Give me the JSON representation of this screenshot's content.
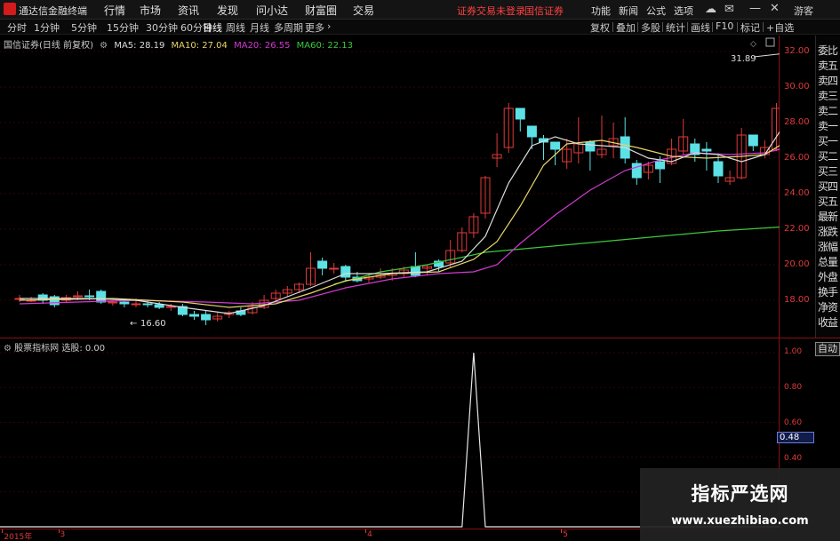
{
  "menubar": {
    "app_title": "通达信金融终端",
    "menu_items": [
      "行情",
      "市场",
      "资讯",
      "发现",
      "问小达",
      "财富圈",
      "交易"
    ],
    "login_notice": "证券交易未登录",
    "broker": "国信证券",
    "utilities": [
      "功能",
      "新闻",
      "公式",
      "选项"
    ],
    "guest_label": "游客",
    "icons": [
      "cloud-icon",
      "mail-icon",
      "minimize-icon",
      "maximize-icon",
      "close-icon"
    ]
  },
  "tabbar": {
    "tabs": [
      "分时",
      "1分钟",
      "5分钟",
      "15分钟",
      "30分钟",
      "60分钟",
      "日线",
      "周线",
      "月线",
      "多周期",
      "更多"
    ],
    "active_tab": "日线",
    "right_buttons": [
      "复权",
      "叠加",
      "多股",
      "统计",
      "画线",
      "F10",
      "标记",
      "+自选"
    ],
    "more_arrow": "›"
  },
  "legend": {
    "stock": "国信证券(日线 前复权)",
    "ma5": "MA5: 28.19",
    "ma10": "MA10: 27.04",
    "ma20": "MA20: 26.55",
    "ma60": "MA60: 22.13"
  },
  "price_axis": {
    "ticks": [
      "32.00",
      "30.00",
      "28.00",
      "26.00",
      "24.00",
      "22.00",
      "20.00",
      "18.00"
    ],
    "high_label": "31.89",
    "low_label": "16.60"
  },
  "side_panel": {
    "top_label": "R\n融",
    "items": [
      "委比",
      "卖五",
      "卖四",
      "卖三",
      "卖二",
      "卖一",
      "买一",
      "买二",
      "买三",
      "买四",
      "买五",
      "最新",
      "涨跌",
      "涨幅",
      "总量",
      "外盘",
      "换手",
      "净资",
      "收益"
    ]
  },
  "indicator": {
    "label": "股票指标网",
    "value_label": "选股: 0.00",
    "ticks": [
      "1.00",
      "0.80",
      "0.60",
      "0.40"
    ],
    "cursor_value": "0.48",
    "auto_button": "自动"
  },
  "xaxis": {
    "ticks": [
      {
        "label": "2015年",
        "pos": 0.005
      },
      {
        "label": "3",
        "pos": 0.077
      },
      {
        "label": "4",
        "pos": 0.471
      },
      {
        "label": "5",
        "pos": 0.722
      }
    ]
  },
  "watermark": {
    "title": "指标严选网",
    "url": "www.xuezhibiao.com"
  },
  "colors": {
    "up": "#e03a3a",
    "down": "#5ce1e6",
    "ma5": "#dcdcdc",
    "ma10": "#e8d56a",
    "ma20": "#d23ad2",
    "ma60": "#3cc83c"
  },
  "candles": [
    [
      18.1,
      18.1,
      18.3,
      17.9
    ],
    [
      17.95,
      18.0,
      18.2,
      17.9
    ],
    [
      18.3,
      18.0,
      18.4,
      17.8
    ],
    [
      18.2,
      17.75,
      18.3,
      17.6
    ],
    [
      18.0,
      18.15,
      18.3,
      17.9
    ],
    [
      18.2,
      18.25,
      18.5,
      18.0
    ],
    [
      18.25,
      18.2,
      18.6,
      18.0
    ],
    [
      18.5,
      17.9,
      18.6,
      17.8
    ],
    [
      17.9,
      17.9,
      18.0,
      17.7
    ],
    [
      17.9,
      17.8,
      18.0,
      17.6
    ],
    [
      17.8,
      17.8,
      18.1,
      17.6
    ],
    [
      17.8,
      17.75,
      18.0,
      17.6
    ],
    [
      17.75,
      17.6,
      17.9,
      17.5
    ],
    [
      17.6,
      17.65,
      17.8,
      17.4
    ],
    [
      17.65,
      17.2,
      17.8,
      17.1
    ],
    [
      17.2,
      17.1,
      17.4,
      16.9
    ],
    [
      17.2,
      16.9,
      17.4,
      16.6
    ],
    [
      16.95,
      17.1,
      17.3,
      16.8
    ],
    [
      17.2,
      17.3,
      17.4,
      17.0
    ],
    [
      17.4,
      17.2,
      17.6,
      17.1
    ],
    [
      17.3,
      17.6,
      17.9,
      17.2
    ],
    [
      17.6,
      18.0,
      18.3,
      17.5
    ],
    [
      18.1,
      18.4,
      18.6,
      17.9
    ],
    [
      18.4,
      18.6,
      18.8,
      18.2
    ],
    [
      18.6,
      18.9,
      19.0,
      18.4
    ],
    [
      18.9,
      19.8,
      20.7,
      18.8
    ],
    [
      20.2,
      19.8,
      20.4,
      19.4
    ],
    [
      19.8,
      19.8,
      20.1,
      19.5
    ],
    [
      19.9,
      19.3,
      20.0,
      19.1
    ],
    [
      19.3,
      19.1,
      19.6,
      19.0
    ],
    [
      19.2,
      19.3,
      19.5,
      19.0
    ],
    [
      19.3,
      19.4,
      19.8,
      19.2
    ],
    [
      19.4,
      19.5,
      19.8,
      19.1
    ],
    [
      19.5,
      19.7,
      19.9,
      19.3
    ],
    [
      19.9,
      19.4,
      20.7,
      19.3
    ],
    [
      19.8,
      19.9,
      20.0,
      19.4
    ],
    [
      20.2,
      19.9,
      20.3,
      19.6
    ],
    [
      20.1,
      20.8,
      21.4,
      19.8
    ],
    [
      20.8,
      21.8,
      22.1,
      20.7
    ],
    [
      21.8,
      22.7,
      22.9,
      21.5
    ],
    [
      22.9,
      24.9,
      25.0,
      22.6
    ],
    [
      26.0,
      26.2,
      27.4,
      25.5
    ],
    [
      26.6,
      28.8,
      29.1,
      26.3
    ],
    [
      28.8,
      28.2,
      28.8,
      27.5
    ],
    [
      27.8,
      27.2,
      27.6,
      26.5
    ],
    [
      27.1,
      26.9,
      27.3,
      25.9
    ],
    [
      26.9,
      26.5,
      26.9,
      25.6
    ],
    [
      25.8,
      26.5,
      27.1,
      25.4
    ],
    [
      26.3,
      26.8,
      28.3,
      25.7
    ],
    [
      26.9,
      26.4,
      27.0,
      25.3
    ],
    [
      26.2,
      26.5,
      28.4,
      26.0
    ],
    [
      26.7,
      27.1,
      28.0,
      26.0
    ],
    [
      27.2,
      26.0,
      28.3,
      25.7
    ],
    [
      25.7,
      24.9,
      25.9,
      24.5
    ],
    [
      25.2,
      25.6,
      25.8,
      24.8
    ],
    [
      25.8,
      25.4,
      26.1,
      24.6
    ],
    [
      25.7,
      26.5,
      27.1,
      25.6
    ],
    [
      26.4,
      27.2,
      28.2,
      26.2
    ],
    [
      26.8,
      26.2,
      27.1,
      25.8
    ],
    [
      26.5,
      26.4,
      26.9,
      25.3
    ],
    [
      25.8,
      25.0,
      26.2,
      24.6
    ],
    [
      24.7,
      24.9,
      25.3,
      24.5
    ],
    [
      24.9,
      27.3,
      27.7,
      24.8
    ],
    [
      27.3,
      26.7,
      27.2,
      26.4
    ],
    [
      26.2,
      26.6,
      27.0,
      26.0
    ],
    [
      26.5,
      28.8,
      29.1,
      26.4
    ],
    [
      28.6,
      31.8,
      31.9,
      28.5
    ]
  ],
  "ma_lines": {
    "ma5": [
      [
        0,
        18.1
      ],
      [
        6,
        18.1
      ],
      [
        10,
        18.0
      ],
      [
        14,
        17.6
      ],
      [
        18,
        17.25
      ],
      [
        21,
        17.7
      ],
      [
        25,
        18.7
      ],
      [
        28,
        19.5
      ],
      [
        31,
        19.5
      ],
      [
        35,
        19.6
      ],
      [
        38,
        20.2
      ],
      [
        40,
        21.6
      ],
      [
        42,
        24.6
      ],
      [
        44,
        26.7
      ],
      [
        46,
        27.2
      ],
      [
        48,
        26.8
      ],
      [
        50,
        26.7
      ],
      [
        52,
        26.6
      ],
      [
        54,
        26.0
      ],
      [
        56,
        25.8
      ],
      [
        58,
        26.3
      ],
      [
        60,
        26.2
      ],
      [
        62,
        25.8
      ],
      [
        64,
        26.2
      ],
      [
        66,
        28.2
      ]
    ],
    "ma10": [
      [
        0,
        18.0
      ],
      [
        8,
        18.1
      ],
      [
        14,
        17.9
      ],
      [
        18,
        17.6
      ],
      [
        22,
        17.8
      ],
      [
        25,
        18.4
      ],
      [
        28,
        19.1
      ],
      [
        32,
        19.5
      ],
      [
        36,
        19.6
      ],
      [
        39,
        20.3
      ],
      [
        41,
        21.3
      ],
      [
        43,
        23.3
      ],
      [
        45,
        25.6
      ],
      [
        47,
        26.8
      ],
      [
        50,
        27.0
      ],
      [
        53,
        26.6
      ],
      [
        56,
        26.1
      ],
      [
        59,
        26.0
      ],
      [
        62,
        26.1
      ],
      [
        64,
        26.2
      ],
      [
        66,
        27.0
      ]
    ],
    "ma20": [
      [
        0,
        17.8
      ],
      [
        10,
        18.0
      ],
      [
        16,
        17.9
      ],
      [
        20,
        17.8
      ],
      [
        24,
        18.0
      ],
      [
        28,
        18.7
      ],
      [
        32,
        19.2
      ],
      [
        36,
        19.5
      ],
      [
        39,
        19.6
      ],
      [
        41,
        20.0
      ],
      [
        43,
        21.2
      ],
      [
        46,
        22.8
      ],
      [
        49,
        24.2
      ],
      [
        52,
        25.3
      ],
      [
        55,
        25.9
      ],
      [
        58,
        26.3
      ],
      [
        61,
        26.2
      ],
      [
        64,
        26.3
      ],
      [
        66,
        26.6
      ]
    ],
    "ma60": [
      [
        27,
        18.9
      ],
      [
        31,
        19.6
      ],
      [
        35,
        20.0
      ],
      [
        40,
        20.7
      ],
      [
        45,
        21.0
      ],
      [
        50,
        21.3
      ],
      [
        55,
        21.6
      ],
      [
        60,
        21.9
      ],
      [
        66,
        22.15
      ]
    ]
  },
  "signal": {
    "peak_index": 39,
    "peak_value": 1.0
  }
}
